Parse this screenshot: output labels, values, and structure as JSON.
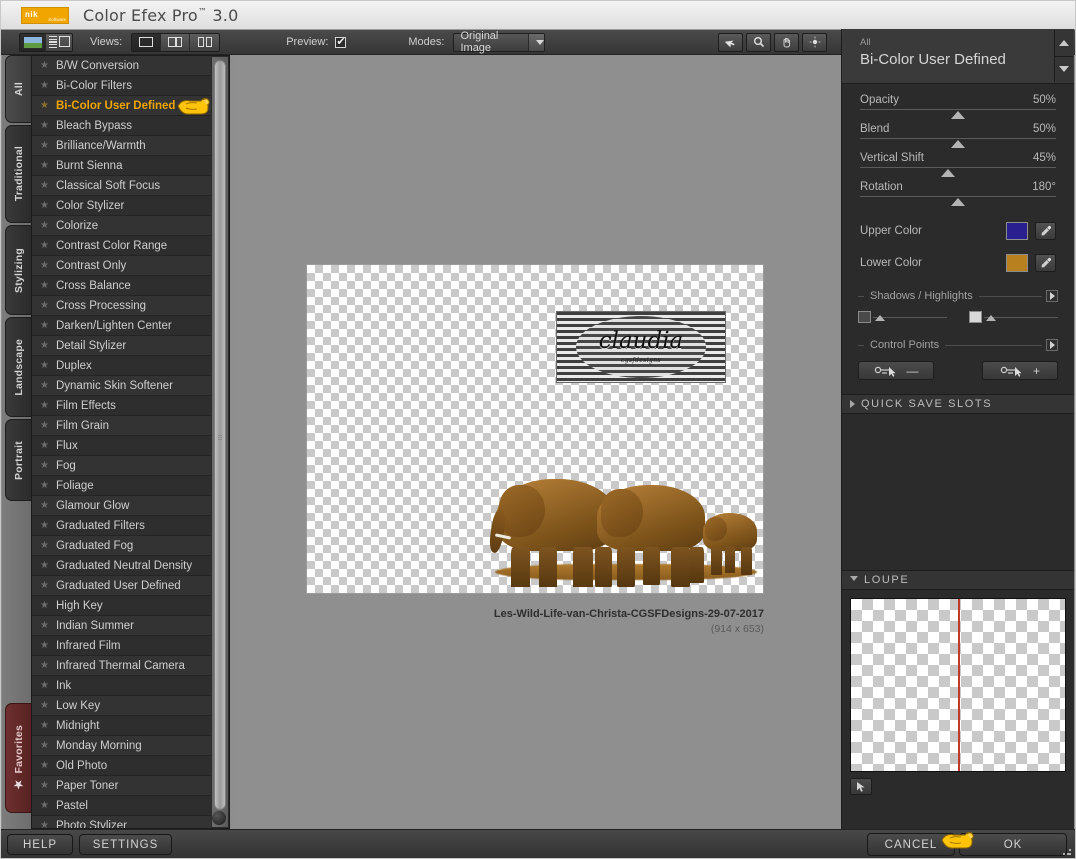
{
  "window": {
    "title": "Color Efex Pro",
    "tm": "™",
    "version": "3.0",
    "logo_text": "nik",
    "logo_sub": "Software"
  },
  "toolbar": {
    "image_view_icon": "image-view-icon",
    "list_view_icon": "list-view-icon",
    "views_label": "Views:",
    "view_single_icon": "single-pane-icon",
    "view_split_icon": "split-pane-icon",
    "view_double_icon": "double-pane-icon",
    "preview_label": "Preview:",
    "preview_checked": true,
    "modes_label": "Modes:",
    "modes_value": "Original Image",
    "tools": [
      {
        "name": "selection-arrow-tool",
        "glyph": "↖"
      },
      {
        "name": "zoom-tool",
        "glyph": "⚲"
      },
      {
        "name": "pan-hand-tool",
        "glyph": "✋"
      },
      {
        "name": "brightness-tool",
        "glyph": "☀"
      }
    ]
  },
  "rail": {
    "tabs": [
      {
        "label": "All",
        "active": true
      },
      {
        "label": "Traditional",
        "active": false
      },
      {
        "label": "Stylizing",
        "active": false
      },
      {
        "label": "Landscape",
        "active": false
      },
      {
        "label": "Portrait",
        "active": false
      }
    ],
    "favorites_label": "Favorites"
  },
  "filters": {
    "selected": "Bi-Color User Defined",
    "items": [
      "B/W Conversion",
      "Bi-Color Filters",
      "Bi-Color User Defined",
      "Bleach Bypass",
      "Brilliance/Warmth",
      "Burnt Sienna",
      "Classical Soft Focus",
      "Color Stylizer",
      "Colorize",
      "Contrast Color Range",
      "Contrast Only",
      "Cross Balance",
      "Cross Processing",
      "Darken/Lighten Center",
      "Detail Stylizer",
      "Duplex",
      "Dynamic Skin Softener",
      "Film Effects",
      "Film Grain",
      "Flux",
      "Fog",
      "Foliage",
      "Glamour Glow",
      "Graduated Filters",
      "Graduated Fog",
      "Graduated Neutral Density",
      "Graduated User Defined",
      "High Key",
      "Indian Summer",
      "Infrared Film",
      "Infrared Thermal Camera",
      "Ink",
      "Low Key",
      "Midnight",
      "Monday Morning",
      "Old Photo",
      "Paper Toner",
      "Pastel",
      "Photo Stylizer"
    ]
  },
  "canvas": {
    "watermark_text": "claudia",
    "watermark_sub": "cgsfdesigns",
    "caption_filename": "Les-Wild-Life-van-Christa-CGSFDesigns-29-07-2017",
    "caption_dimensions": "(914 x 653)"
  },
  "right_panel": {
    "category": "All",
    "filter_name": "Bi-Color User Defined",
    "scroll_up_icon": "scroll-up-icon",
    "scroll_down_icon": "scroll-down-icon",
    "parameters": [
      {
        "name": "Opacity",
        "value": "50%",
        "pos": 50
      },
      {
        "name": "Blend",
        "value": "50%",
        "pos": 50
      },
      {
        "name": "Vertical Shift",
        "value": "45%",
        "pos": 45
      },
      {
        "name": "Rotation",
        "value": "180°",
        "pos": 50
      }
    ],
    "colors": [
      {
        "label": "Upper Color",
        "hex": "#2a1f8f",
        "picker_icon": "eyedropper-icon"
      },
      {
        "label": "Lower Color",
        "hex": "#b8801f",
        "picker_icon": "eyedropper-icon"
      }
    ],
    "shadows_highlights": {
      "title": "Shadows / Highlights",
      "expand_icon": "expand-arrow-icon",
      "shadow_swatch": "#4a4a4a",
      "highlight_swatch": "#d8d8d8"
    },
    "control_points": {
      "title": "Control Points",
      "expand_icon": "expand-arrow-icon",
      "remove_label": "—",
      "add_label": "+",
      "remove_icon": "control-point-minus-icon",
      "add_icon": "control-point-plus-icon"
    },
    "quick_save_slots": {
      "title": "QUICK SAVE SLOTS",
      "expanded": false
    },
    "loupe": {
      "title": "LOUPE",
      "expanded": true,
      "pin_icon": "pin-icon",
      "guide_color": "#c0392b"
    }
  },
  "bottom": {
    "help_label": "HELP",
    "settings_label": "SETTINGS",
    "cancel_label": "CANCEL",
    "ok_label": "OK",
    "resize_grip_icon": "resize-grip-icon"
  },
  "cursor": {
    "icon": "pointing-hand-cursor",
    "color": "#ffc40a"
  }
}
